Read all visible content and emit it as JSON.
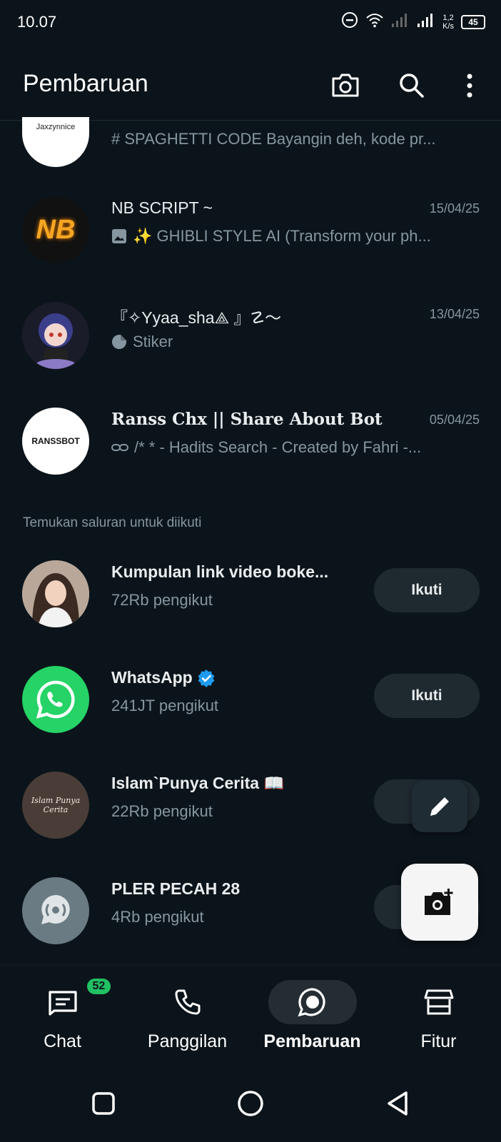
{
  "status_bar": {
    "time": "10.07",
    "net_speed_value": "1,2",
    "net_speed_unit": "K/s",
    "battery": "45"
  },
  "header": {
    "title": "Pembaruan"
  },
  "channels": [
    {
      "avatar_text": "Jaxzynnice",
      "title": "",
      "date": "",
      "preview": "# SPAGHETTI CODE  Bayangin deh, kode pr..."
    },
    {
      "avatar_text": "NB",
      "title": "NB SCRIPT ~",
      "date": "15/04/25",
      "preview_icon": "image-icon",
      "preview": "✨ GHIBLI STYLE AI (Transform your ph..."
    },
    {
      "title": "『✧Yyaa_sha⟁ 』☡〜",
      "date": "13/04/25",
      "preview_icon": "sticker-icon",
      "preview": "Stiker"
    },
    {
      "avatar_text": "RANSSBOT",
      "title": "Ranss Chx || Share About Bot",
      "date": "05/04/25",
      "preview_icon": "link-icon",
      "preview": "/* * - Hadits Search - Created by Fahri -..."
    }
  ],
  "discover": {
    "label": "Temukan saluran untuk diikuti",
    "follow_label": "Ikuti",
    "items": [
      {
        "title": "Kumpulan link video boke...",
        "followers": "72Rb pengikut"
      },
      {
        "title": "WhatsApp",
        "verified": true,
        "followers": "241JT pengikut"
      },
      {
        "title": "Islam`Punya Cerita 📖",
        "avatar_text": "Islam Punya Cerita",
        "followers": "22Rb pengikut"
      },
      {
        "title": "PLER PECAH 28",
        "followers": "4Rb pengikut"
      }
    ]
  },
  "bottom_nav": {
    "items": [
      {
        "label": "Chat",
        "badge": "52"
      },
      {
        "label": "Panggilan"
      },
      {
        "label": "Pembaruan",
        "active": true
      },
      {
        "label": "Fitur"
      }
    ]
  },
  "colors": {
    "background": "#0b141a",
    "accent_green": "#21c063",
    "verified_blue": "#1d9bf0",
    "secondary_text": "#8696a0"
  }
}
